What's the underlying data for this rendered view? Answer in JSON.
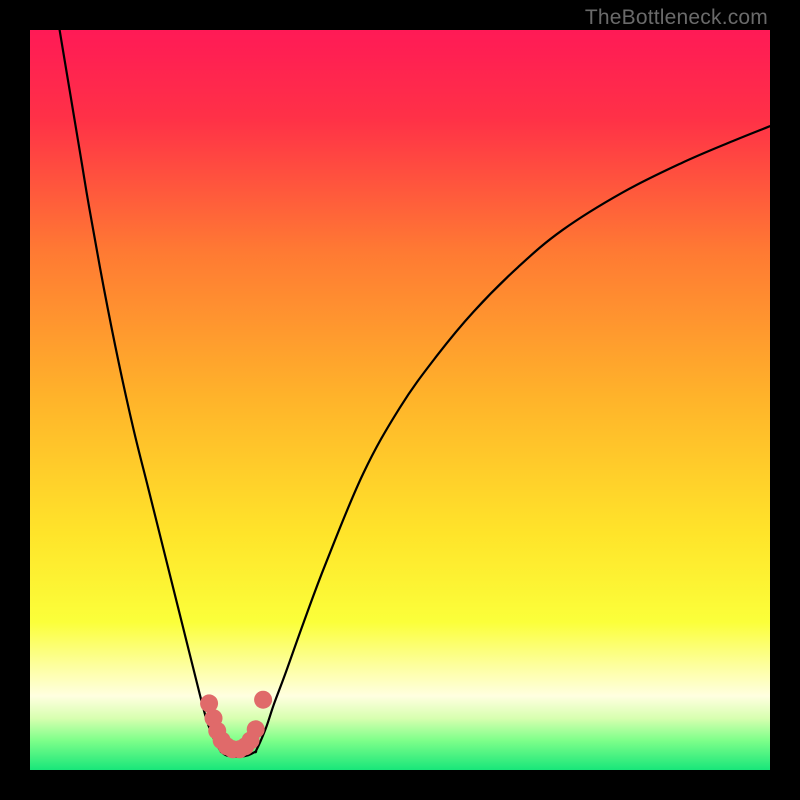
{
  "watermark": "TheBottleneck.com",
  "chart_data": {
    "type": "line",
    "title": "",
    "xlabel": "",
    "ylabel": "",
    "xlim": [
      0,
      100
    ],
    "ylim": [
      0,
      100
    ],
    "grid": false,
    "legend": false,
    "background_gradient": {
      "stops": [
        {
          "pos": 0.0,
          "color": "#ff1a56"
        },
        {
          "pos": 0.12,
          "color": "#ff3147"
        },
        {
          "pos": 0.3,
          "color": "#ff7a33"
        },
        {
          "pos": 0.5,
          "color": "#ffb42a"
        },
        {
          "pos": 0.68,
          "color": "#ffe42a"
        },
        {
          "pos": 0.8,
          "color": "#fbff3a"
        },
        {
          "pos": 0.86,
          "color": "#fdffa0"
        },
        {
          "pos": 0.9,
          "color": "#ffffe0"
        },
        {
          "pos": 0.93,
          "color": "#d8ffb0"
        },
        {
          "pos": 0.96,
          "color": "#7eff8a"
        },
        {
          "pos": 1.0,
          "color": "#18e67a"
        }
      ]
    },
    "series": [
      {
        "name": "left-branch",
        "x": [
          4,
          5,
          6,
          7,
          8,
          10,
          12,
          14,
          16,
          18,
          20,
          21,
          22,
          23,
          23.8,
          24.5,
          25.2,
          25.8
        ],
        "y": [
          100,
          94,
          88,
          82,
          76,
          65,
          55,
          46,
          38,
          30,
          22,
          18,
          14,
          10,
          7,
          5,
          3.5,
          2.5
        ]
      },
      {
        "name": "valley-floor",
        "x": [
          25.8,
          26.5,
          27.5,
          28.5,
          29.5,
          30.5
        ],
        "y": [
          2.5,
          2.0,
          1.8,
          1.8,
          2.0,
          2.5
        ]
      },
      {
        "name": "right-branch",
        "x": [
          30.5,
          31.2,
          32,
          33,
          34.5,
          37,
          40,
          45,
          50,
          55,
          60,
          66,
          72,
          80,
          88,
          95,
          100
        ],
        "y": [
          2.5,
          4,
          6,
          9,
          13,
          20,
          28,
          40,
          49,
          56,
          62,
          68,
          73,
          78,
          82,
          85,
          87
        ]
      }
    ],
    "scatter": {
      "name": "valley-markers",
      "color": "#e06a6a",
      "points": [
        {
          "x": 24.2,
          "y": 9.0
        },
        {
          "x": 24.8,
          "y": 7.0
        },
        {
          "x": 25.3,
          "y": 5.3
        },
        {
          "x": 25.9,
          "y": 4.0
        },
        {
          "x": 26.6,
          "y": 3.2
        },
        {
          "x": 27.4,
          "y": 2.8
        },
        {
          "x": 28.3,
          "y": 2.8
        },
        {
          "x": 29.1,
          "y": 3.2
        },
        {
          "x": 29.8,
          "y": 4.0
        },
        {
          "x": 30.5,
          "y": 5.5
        },
        {
          "x": 31.5,
          "y": 9.5
        }
      ]
    }
  }
}
